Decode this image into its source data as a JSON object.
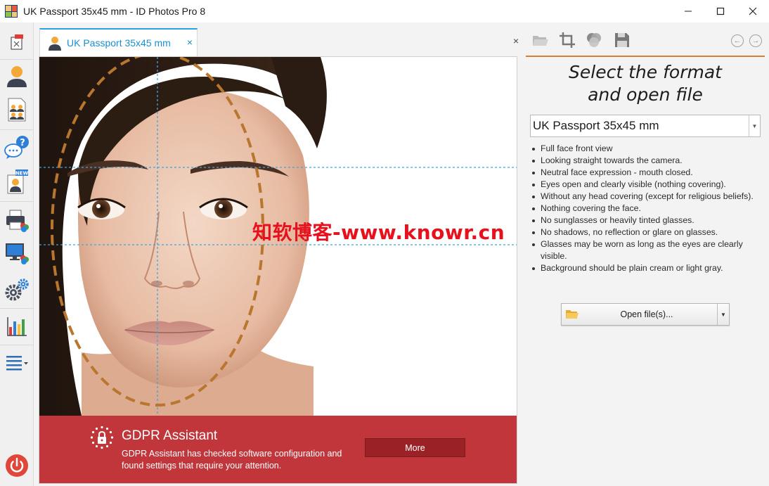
{
  "window": {
    "title": "UK Passport 35x45 mm - ID Photos Pro 8",
    "icon": "app-icon",
    "controls": [
      "minimize-icon",
      "maximize-icon",
      "close-icon"
    ]
  },
  "sidebar": {
    "items": [
      {
        "name": "new-document-icon"
      },
      {
        "name": "single-person-icon"
      },
      {
        "name": "group-persons-icon"
      },
      {
        "name": "help-chat-icon"
      },
      {
        "name": "new-person-icon",
        "badge": "NEW"
      },
      {
        "name": "print-icon"
      },
      {
        "name": "monitor-color-icon"
      },
      {
        "name": "settings-gears-icon"
      },
      {
        "name": "statistics-chart-icon"
      },
      {
        "name": "menu-list-icon"
      },
      {
        "name": "power-icon"
      }
    ]
  },
  "tab": {
    "label": "UK Passport 35x45 mm",
    "close": "×"
  },
  "document": {
    "close": "×",
    "watermark": "知软博客-www.knowr.cn"
  },
  "gdpr": {
    "title": "GDPR Assistant",
    "message": "GDPR Assistant has checked software configuration and found settings that require your attention.",
    "more_label": "More"
  },
  "panel": {
    "toolbar": [
      "open-folder-icon",
      "crop-icon",
      "color-balls-icon",
      "save-disk-icon"
    ],
    "nav_back": "←",
    "nav_forward": "→",
    "heading_line1": "Select the format",
    "heading_line2": "and open file",
    "format_selected": "UK Passport 35x45 mm",
    "requirements": [
      "Full face front view",
      "Looking straight towards the camera.",
      "Neutral face expression - mouth closed.",
      "Eyes open and clearly visible (nothing covering).",
      "Without any head covering (except for religious beliefs).",
      "Nothing covering the face.",
      "No sunglasses or heavily tinted glasses.",
      "No shadows, no reflection or glare on glasses.",
      "Glasses may be worn as long as the eyes are clearly visible.",
      "Background should be plain cream or light gray."
    ],
    "open_label": "Open file(s)..."
  },
  "colors": {
    "accent_blue": "#2aa3de",
    "accent_orange": "#e07a2d",
    "gdpr_red": "#c0363a",
    "guide_blue": "#3aa7e0",
    "oval_brown": "#b8762f"
  }
}
